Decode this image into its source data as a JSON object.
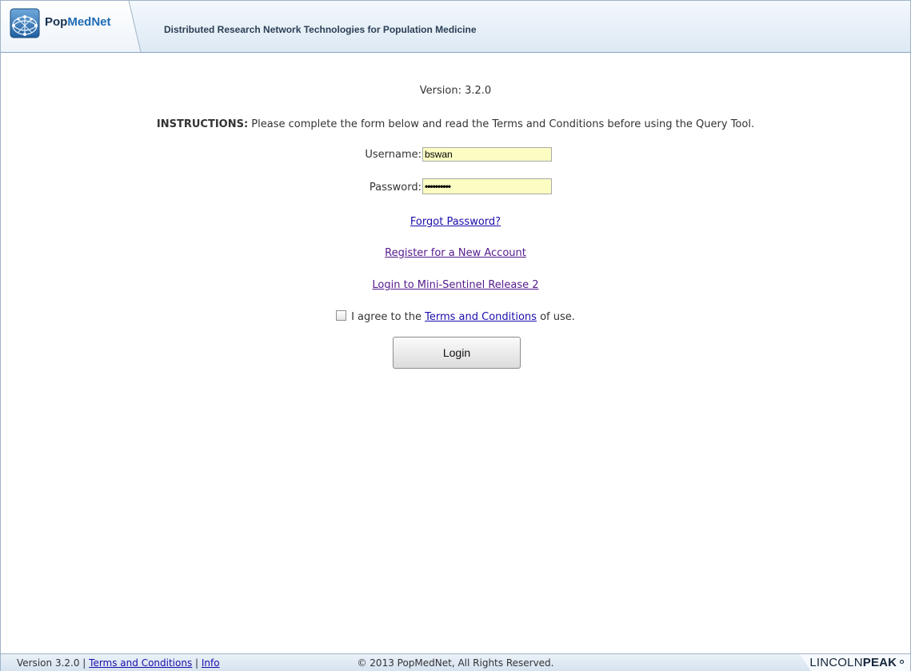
{
  "header": {
    "brand_prefix": "Pop",
    "brand_accent": "MedNet",
    "tagline": "Distributed Research Network Technologies for Population Medicine"
  },
  "main": {
    "version": "Version: 3.2.0",
    "instructions_bold": "INSTRUCTIONS:",
    "instructions_text": " Please complete the form below and read the Terms and Conditions before using the Query Tool.",
    "username_label": "Username:",
    "username_value": "bswan",
    "password_label": "Password:",
    "password_value": "••••••••••",
    "forgot_password": "Forgot Password?",
    "register": "Register for a New Account",
    "mini_sentinel": "Login to Mini-Sentinel Release 2",
    "agree_prefix": "I agree to the ",
    "agree_link": "Terms and Conditions",
    "agree_suffix": " of use.",
    "login_button": "Login"
  },
  "footer": {
    "version": "Version 3.2.0",
    "sep1": " | ",
    "terms_link": "Terms and Conditions",
    "sep2": " | ",
    "info_link": "Info",
    "copyright": "© 2013 PopMedNet, All Rights Reserved.",
    "partner_light": "LINCOLN",
    "partner_bold": "PEAK"
  },
  "colors": {
    "input_bg": "#fbfdc2",
    "link": "#1a0dab",
    "link_visited": "#551a8b",
    "header_border": "#8aa6c1"
  },
  "icons": {
    "logo": "network-globe-icon",
    "partner_logo": "lincolnpeak-logo"
  }
}
